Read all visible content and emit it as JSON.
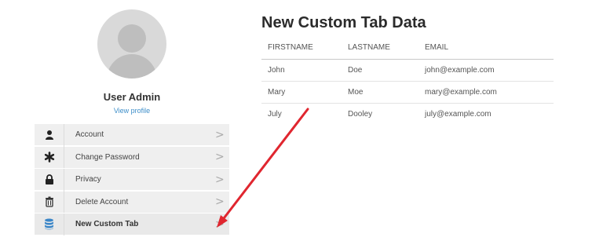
{
  "profile": {
    "name": "User Admin",
    "view_profile": "View profile"
  },
  "menu": {
    "items": [
      {
        "label": "Account",
        "icon": "user-icon"
      },
      {
        "label": "Change Password",
        "icon": "asterisk-icon"
      },
      {
        "label": "Privacy",
        "icon": "lock-icon"
      },
      {
        "label": "Delete Account",
        "icon": "trash-icon"
      },
      {
        "label": "New Custom Tab",
        "icon": "database-icon",
        "active": true
      }
    ],
    "chevron": ">"
  },
  "content": {
    "title": "New Custom Tab Data",
    "columns": [
      "FIRSTNAME",
      "LASTNAME",
      "EMAIL"
    ],
    "rows": [
      [
        "John",
        "Doe",
        "john@example.com"
      ],
      [
        "Mary",
        "Moe",
        "mary@example.com"
      ],
      [
        "July",
        "Dooley",
        "july@example.com"
      ]
    ]
  },
  "colors": {
    "accent_link": "#3d8ec9",
    "active_icon": "#3a86c8",
    "annotation_arrow": "#e0262f"
  }
}
